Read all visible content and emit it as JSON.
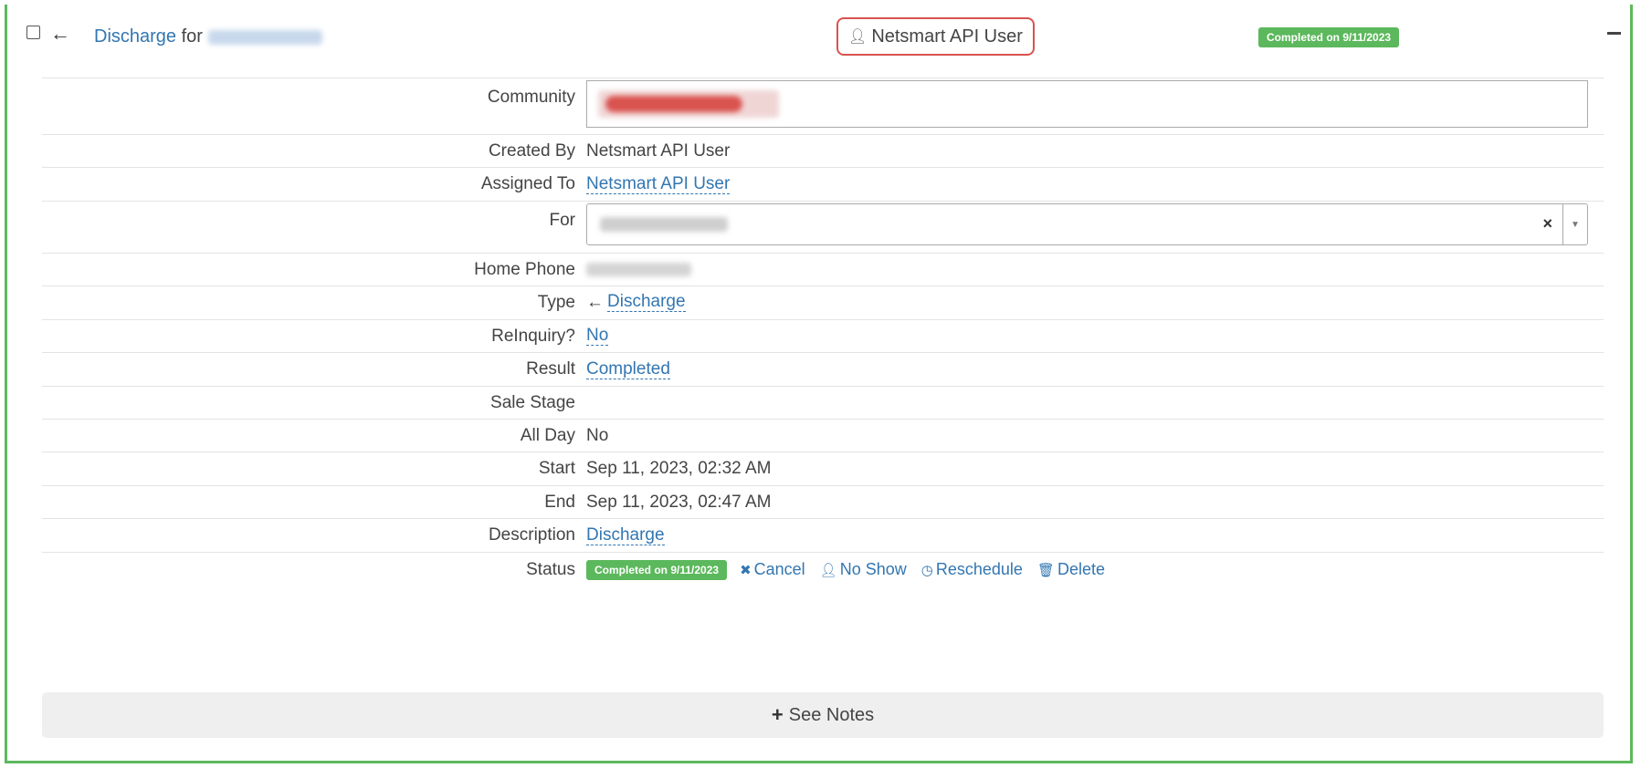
{
  "header": {
    "title_link": "Discharge",
    "title_for": "for",
    "assigned_user": "Netsmart API User",
    "status_badge": "Completed on 9/11/2023"
  },
  "fields": {
    "community_label": "Community",
    "created_by_label": "Created By",
    "created_by_value": "Netsmart API User",
    "assigned_to_label": "Assigned To",
    "assigned_to_value": "Netsmart API User",
    "for_label": "For",
    "home_phone_label": "Home Phone",
    "type_label": "Type",
    "type_value": "Discharge",
    "reinquiry_label": "ReInquiry?",
    "reinquiry_value": "No",
    "result_label": "Result",
    "result_value": "Completed",
    "sale_stage_label": "Sale Stage",
    "sale_stage_value": "",
    "all_day_label": "All Day",
    "all_day_value": "No",
    "start_label": "Start",
    "start_value": "Sep 11, 2023, 02:32 AM",
    "end_label": "End",
    "end_value": "Sep 11, 2023, 02:47 AM",
    "description_label": "Description",
    "description_value": "Discharge",
    "status_label": "Status",
    "status_value": "Completed on 9/11/2023"
  },
  "actions": {
    "cancel": "Cancel",
    "no_show": "No Show",
    "reschedule": "Reschedule",
    "delete": "Delete"
  },
  "notes": {
    "label": "See Notes"
  },
  "colors": {
    "success": "#5cb85c",
    "link": "#3276b1",
    "highlight": "#d9534f"
  }
}
